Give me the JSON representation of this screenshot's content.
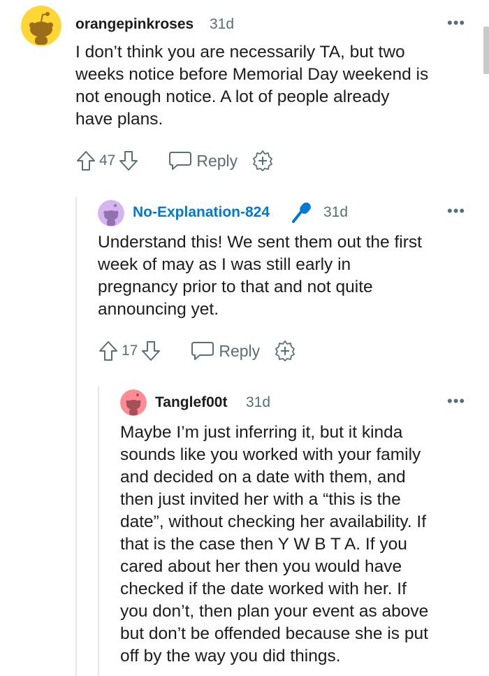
{
  "comments": [
    {
      "username": "orangepinkroses",
      "time": "31d",
      "more": "•••",
      "lines": [
        "I don’t think you are necessarily TA, but two",
        "weeks notice before Memorial Day weekend is",
        "not enough notice. A lot of people already",
        "have plans."
      ],
      "score": "47",
      "reply_label": "Reply",
      "avatar_color": "#ffd635"
    },
    {
      "username": "No-Explanation-824",
      "time": "31d",
      "more": "•••",
      "lines": [
        "Understand this! We sent them out the first",
        "week of may as I was still early in",
        "pregnancy prior to that and not quite",
        "announcing yet."
      ],
      "score": "17",
      "reply_label": "Reply",
      "avatar_color": "#d4b5f0"
    },
    {
      "username": "Tanglef00t",
      "time": "31d",
      "more": "•••",
      "lines": [
        "Maybe I’m just inferring it, but it kinda",
        "sounds like you worked with your family",
        "and decided on a date with them, and",
        "then just invited her with a “this is the",
        "date”, without checking her availability. If",
        "that is the case then Y W B T A. If you",
        "cared about her then you would have",
        "checked if the date worked with her. If",
        "you don’t, then plan your event as above",
        "but don’t be offended because she is put",
        "off by the way you did things."
      ],
      "avatar_color": "#ff8c95"
    }
  ],
  "colors": {
    "op_accent": "#0079d3",
    "meta_gray": "#576f76"
  },
  "icons": {
    "upvote": "upvote-arrow-icon",
    "downvote": "downvote-arrow-icon",
    "reply": "speech-bubble-icon",
    "award": "award-plus-icon",
    "op_badge": "microphone-icon",
    "more": "more-options-icon"
  }
}
